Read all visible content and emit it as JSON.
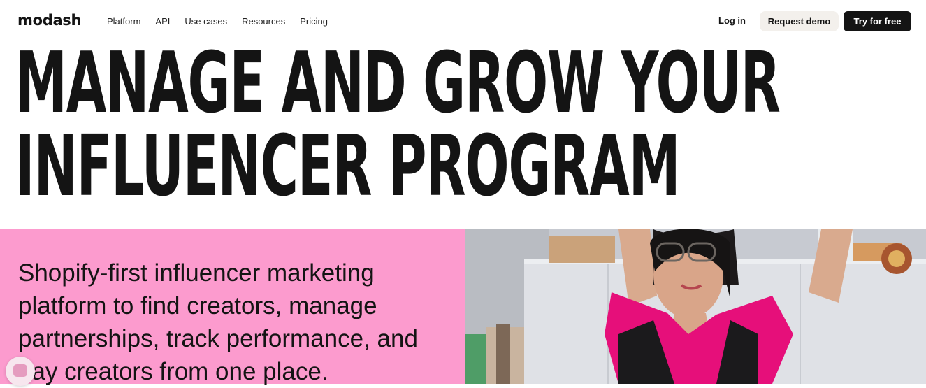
{
  "brand": "modash",
  "nav": {
    "items": [
      "Platform",
      "API",
      "Use cases",
      "Resources",
      "Pricing"
    ],
    "login": "Log in",
    "demo": "Request demo",
    "try": "Try for free"
  },
  "hero": {
    "line1": "MANAGE AND GROW YOUR",
    "line2": "INFLUENCER PROGRAM",
    "subtitle": "Shopify-first influencer marketing platform to find creators, manage partnerships, track performance, and pay creators from one place."
  },
  "colors": {
    "pink": "#fc9bce",
    "dark": "#141414",
    "demo_bg": "#f3f0ec"
  },
  "icons": [
    "chat-icon"
  ]
}
